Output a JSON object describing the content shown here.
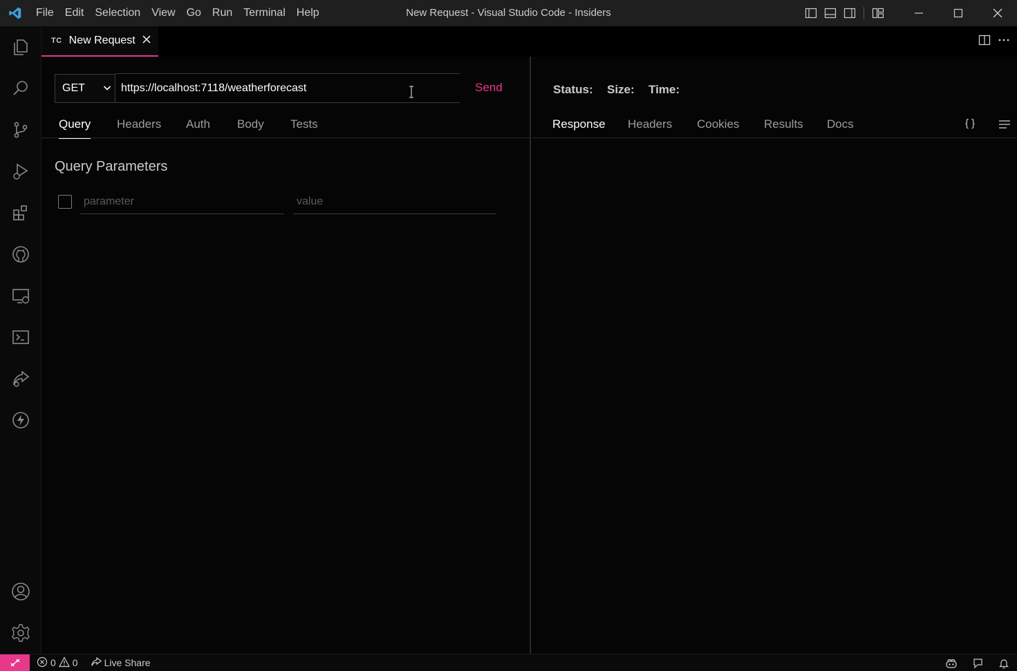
{
  "window": {
    "title": "New Request - Visual Studio Code - Insiders",
    "menu": [
      "File",
      "Edit",
      "Selection",
      "View",
      "Go",
      "Run",
      "Terminal",
      "Help"
    ]
  },
  "activity_bar": {
    "icons": [
      "explorer-icon",
      "search-icon",
      "source-control-icon",
      "run-debug-icon",
      "extensions-icon",
      "github-icon",
      "remote-explorer-icon",
      "terminal-icon",
      "live-share-icon",
      "thunder-client-icon"
    ],
    "bottom_icons": [
      "account-icon",
      "settings-gear-icon"
    ]
  },
  "tab": {
    "mark": "TC",
    "label": "New Request"
  },
  "request": {
    "method": "GET",
    "url": "https://localhost:7118/weatherforecast",
    "send_label": "Send",
    "tabs": [
      "Query",
      "Headers",
      "Auth",
      "Body",
      "Tests"
    ],
    "active_tab": "Query",
    "query_title": "Query Parameters",
    "param_placeholder": "parameter",
    "value_placeholder": "value"
  },
  "response": {
    "status_label": "Status:",
    "size_label": "Size:",
    "time_label": "Time:",
    "tabs": [
      "Response",
      "Headers",
      "Cookies",
      "Results",
      "Docs"
    ],
    "active_tab": "Response",
    "json_icon_label": "{ }"
  },
  "status_bar": {
    "errors": "0",
    "warnings": "0",
    "live_share": "Live Share"
  },
  "colors": {
    "accent": "#e8388a",
    "vscode_logo": "#3aa0e0"
  }
}
